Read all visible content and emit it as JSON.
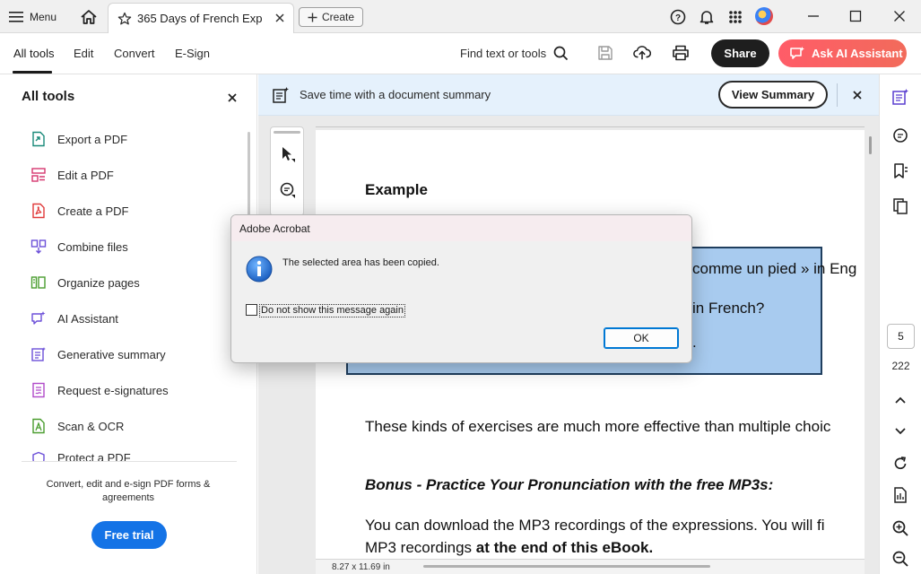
{
  "titlebar": {
    "menu_label": "Menu",
    "tab_title": "365 Days of French Expr...",
    "create_label": "Create"
  },
  "toolbar": {
    "nav": [
      "All tools",
      "Edit",
      "Convert",
      "E-Sign"
    ],
    "find_label": "Find text or tools",
    "share_label": "Share",
    "ai_label": "Ask AI Assistant"
  },
  "left_panel": {
    "title": "All tools",
    "items": [
      {
        "label": "Export a PDF",
        "icon": "export-pdf-icon",
        "color": "#1a8a7a"
      },
      {
        "label": "Edit a PDF",
        "icon": "edit-pdf-icon",
        "color": "#d6376f"
      },
      {
        "label": "Create a PDF",
        "icon": "create-pdf-icon",
        "color": "#e03a3a"
      },
      {
        "label": "Combine files",
        "icon": "combine-files-icon",
        "color": "#6b4fd8"
      },
      {
        "label": "Organize pages",
        "icon": "organize-pages-icon",
        "color": "#4a9d2f"
      },
      {
        "label": "AI Assistant",
        "icon": "ai-assistant-icon",
        "color": "#6b4fd8"
      },
      {
        "label": "Generative summary",
        "icon": "generative-summary-icon",
        "color": "#6b4fd8"
      },
      {
        "label": "Request e-signatures",
        "icon": "request-esignatures-icon",
        "color": "#b04ac9"
      },
      {
        "label": "Scan & OCR",
        "icon": "scan-ocr-icon",
        "color": "#4a9d2f"
      },
      {
        "label": "Protect a PDF",
        "icon": "protect-pdf-icon",
        "color": "#6b4fd8"
      }
    ],
    "footer_text": "Convert, edit and e-sign PDF forms & agreements",
    "trial_label": "Free trial"
  },
  "banner": {
    "text": "Save time with a document summary",
    "button_label": "View Summary"
  },
  "document": {
    "heading": "Example",
    "box_lines": [
      "comme un pied » in Eng",
      "in French?",
      "."
    ],
    "line1": "These kinds of exercises are much more effective than multiple choic",
    "bonus": "Bonus - Practice Your Pronunciation with the free MP3s:",
    "line2": "You can download the MP3 recordings of the expressions. You will fi",
    "line3_normal": "MP3 recordings ",
    "line3_bold": "at the end of this eBook.",
    "page_size": "8.27 x 11.69 in"
  },
  "page_nav": {
    "current_page": "5",
    "total_pages": "222"
  },
  "dialog": {
    "title": "Adobe Acrobat",
    "message": "The selected area has been copied.",
    "checkbox_label": "Do not show this message again",
    "checkbox_checked": false,
    "ok_label": "OK"
  },
  "colors": {
    "accent_blue": "#1473e6",
    "ai_gradient_start": "#ff5c68",
    "banner_bg": "#e5f1fc",
    "highlight_box": "#a8cbef"
  }
}
